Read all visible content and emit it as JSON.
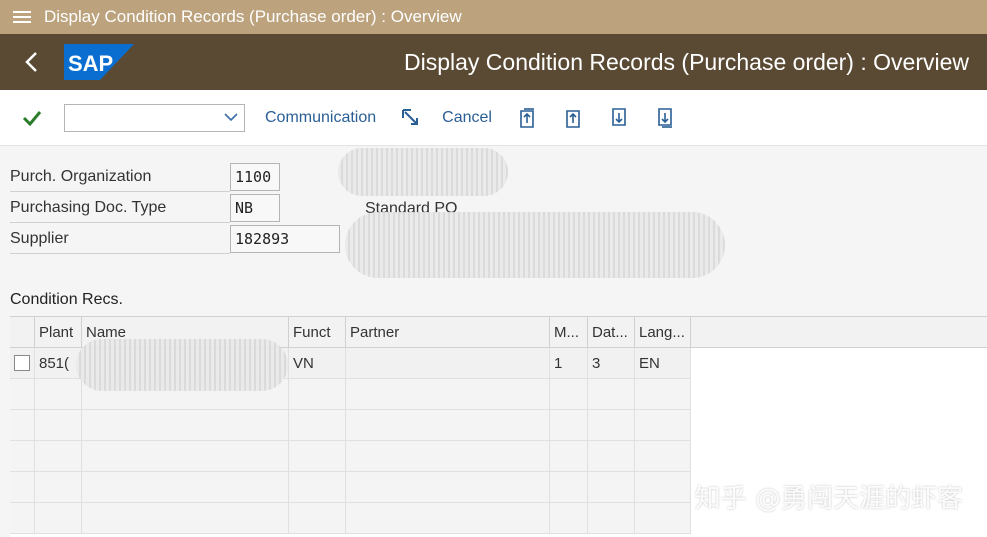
{
  "window": {
    "title": "Display Condition Records (Purchase order) : Overview"
  },
  "shell": {
    "back_icon": "chevron-left-icon",
    "logo_text": "SAP",
    "logo_color": "#0a6ed1",
    "page_title": "Display Condition Records (Purchase order) : Overview"
  },
  "toolbar": {
    "combo_value": "",
    "communication_label": "Communication",
    "cancel_label": "Cancel",
    "icons": [
      "enter-check-icon",
      "cursor-select-icon",
      "first-page-icon",
      "previous-page-icon",
      "next-page-icon",
      "last-page-icon"
    ]
  },
  "header_fields": {
    "purch_org": {
      "label": "Purch. Organization",
      "value": "1100"
    },
    "doc_type": {
      "label": "Purchasing Doc. Type",
      "value": "NB",
      "description": "Standard PO"
    },
    "supplier": {
      "label": "Supplier",
      "value": "182893"
    }
  },
  "condition_records": {
    "title": "Condition Recs.",
    "columns": [
      "Plant",
      "Name",
      "Funct",
      "Partner",
      "M...",
      "Dat...",
      "Lang..."
    ],
    "rows": [
      {
        "plant": "851(",
        "name": "",
        "funct": "VN",
        "partner": "",
        "m": "1",
        "dat": "3",
        "lang": "EN"
      }
    ]
  },
  "watermark": "知乎 @勇闯天涯的虾客"
}
